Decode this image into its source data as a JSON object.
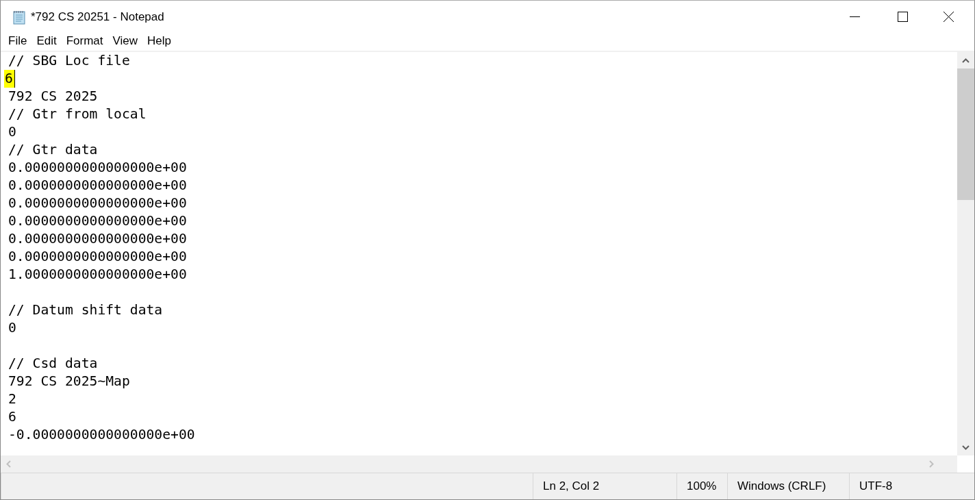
{
  "window": {
    "title": "*792 CS 20251 - Notepad"
  },
  "menu": [
    {
      "label": "File"
    },
    {
      "label": "Edit"
    },
    {
      "label": "Format"
    },
    {
      "label": "View"
    },
    {
      "label": "Help"
    }
  ],
  "editor": {
    "lines": [
      {
        "kind": "text",
        "text": "// SBG Loc file",
        "selected": false
      },
      {
        "kind": "text",
        "text": "6",
        "selected": true
      },
      {
        "kind": "text",
        "text": "792 CS 2025",
        "selected": false
      },
      {
        "kind": "text",
        "text": "// Gtr from local",
        "selected": false
      },
      {
        "kind": "text",
        "text": "0",
        "selected": false
      },
      {
        "kind": "text",
        "text": "// Gtr data",
        "selected": false
      },
      {
        "kind": "text",
        "text": "0.0000000000000000e+00",
        "selected": false
      },
      {
        "kind": "text",
        "text": "0.0000000000000000e+00",
        "selected": false
      },
      {
        "kind": "text",
        "text": "0.0000000000000000e+00",
        "selected": false
      },
      {
        "kind": "text",
        "text": "0.0000000000000000e+00",
        "selected": false
      },
      {
        "kind": "text",
        "text": "0.0000000000000000e+00",
        "selected": false
      },
      {
        "kind": "text",
        "text": "0.0000000000000000e+00",
        "selected": false
      },
      {
        "kind": "text",
        "text": "1.0000000000000000e+00",
        "selected": false
      },
      {
        "kind": "blank"
      },
      {
        "kind": "text",
        "text": "// Datum shift data",
        "selected": false
      },
      {
        "kind": "text",
        "text": "0",
        "selected": false
      },
      {
        "kind": "blank"
      },
      {
        "kind": "text",
        "text": "// Csd data",
        "selected": false
      },
      {
        "kind": "text",
        "text": "792 CS 2025~Map",
        "selected": false
      },
      {
        "kind": "text",
        "text": "2",
        "selected": false
      },
      {
        "kind": "text",
        "text": "6",
        "selected": false
      },
      {
        "kind": "text",
        "text": "-0.0000000000000000e+00",
        "selected": false
      }
    ]
  },
  "status_bar": [
    "Ln 2, Col 2",
    "100%",
    "Windows (CRLF)",
    "UTF-8"
  ]
}
